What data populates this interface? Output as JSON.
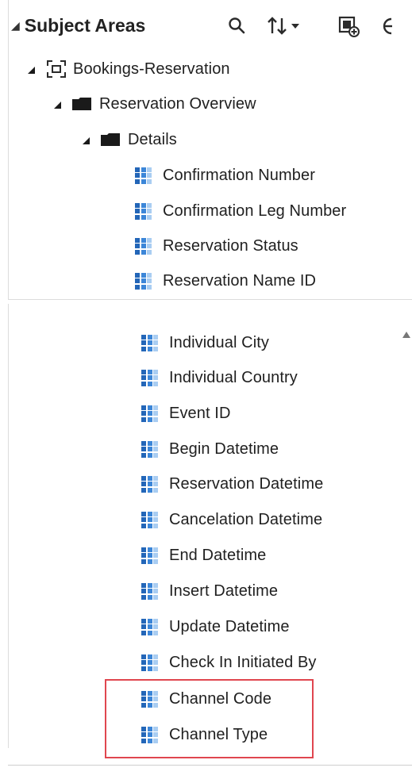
{
  "header": {
    "title": "Subject Areas"
  },
  "icons": {
    "collapse": "triangle-down-icon",
    "search": "search-icon",
    "sort": "sort-icon",
    "add_data": "add-data-icon",
    "more": "more-icon"
  },
  "colors": {
    "field_icon": "#3c86d8",
    "highlight": "#e0464f"
  },
  "tree": {
    "subject_area": "Bookings-Reservation",
    "folder": "Reservation Overview",
    "subfolder": "Details",
    "columns_top": [
      "Confirmation Number",
      "Confirmation Leg Number",
      "Reservation Status",
      "Reservation Name ID"
    ],
    "columns_bottom": [
      "Individual City",
      "Individual Country",
      "Event ID",
      "Begin Datetime",
      "Reservation Datetime",
      "Cancelation Datetime",
      "End Datetime",
      "Insert Datetime",
      "Update Datetime",
      "Check In Initiated By",
      "Channel Code",
      "Channel Type"
    ]
  }
}
